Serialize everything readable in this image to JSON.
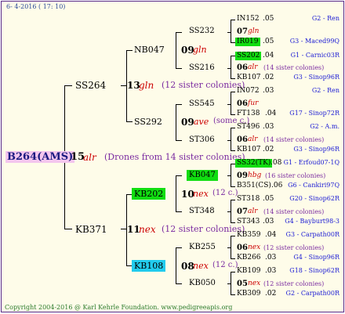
{
  "header": "6- 4-2016 ( 17: 10)",
  "footer": "Copyright 2004-2016 @ Karl Kehrle Foundation.   www.pedigreeapis.org",
  "root": {
    "id": "B264(AMS)",
    "num": "15",
    "race": "alr",
    "note": "(Drones from 14 sister colonies)"
  },
  "gen1": [
    {
      "id": "SS264",
      "num": "13",
      "race": "gln",
      "note": "(12 sister colonies)"
    },
    {
      "id": "KB371",
      "num": "11",
      "race": "nex",
      "note": "(12 sister colonies)"
    }
  ],
  "gen2": [
    {
      "id": "NB047",
      "num": "09",
      "race": "gln",
      "note": ""
    },
    {
      "id": "SS292",
      "num": "09",
      "race": "ave",
      "note": "(some c.)"
    },
    {
      "id": "KB202",
      "num": "10",
      "race": "nex",
      "note": "(12 c.)"
    },
    {
      "id": "KB108",
      "num": "08",
      "race": "nex",
      "note": "(12 c.)"
    }
  ],
  "gen3": [
    {
      "id": "SS232",
      "num": "07",
      "race": "gln",
      "note": ""
    },
    {
      "id": "SS216",
      "num": "06",
      "race": "alr",
      "note": "(14 sister colonies)"
    },
    {
      "id": "SS545",
      "num": "06",
      "race": "fur",
      "note": ""
    },
    {
      "id": "ST306",
      "num": "06",
      "race": "alr",
      "note": "(14 sister colonies)"
    },
    {
      "id": "KB047",
      "num": "09",
      "race": "hbg",
      "note": "(16 sister colonies)"
    },
    {
      "id": "ST348",
      "num": "07",
      "race": "alr",
      "note": "(14 sister colonies)"
    },
    {
      "id": "KB255",
      "num": "06",
      "race": "nex",
      "note": "(12 sister colonies)"
    },
    {
      "id": "KB050",
      "num": "05",
      "race": "nex",
      "note": "(12 sister colonies)"
    }
  ],
  "gen4": [
    {
      "id": "IN152",
      "year": ".05",
      "origin": "G2 - Ren"
    },
    {
      "id": "IR019",
      "year": ".05",
      "origin": "G3 - Maced99Q"
    },
    {
      "id": "SS202",
      "year": ".04",
      "origin": "G1 - Carnic03R"
    },
    {
      "id": "KB107",
      "year": ".02",
      "origin": "G3 - Sinop96R"
    },
    {
      "id": "IN072",
      "year": ".03",
      "origin": "G2 - Ren"
    },
    {
      "id": "FT138",
      "year": ".04",
      "origin": "G17 - Sinop72R"
    },
    {
      "id": "ST496",
      "year": ".03",
      "origin": "G2 - A.m."
    },
    {
      "id": "KB107",
      "year": ".02",
      "origin": "G3 - Sinop96R"
    },
    {
      "id": "SS32(TK)",
      "year": ".08",
      "origin": "G1 - Erfoud07-1Q"
    },
    {
      "id": "B351(CS)",
      "year": ".06",
      "origin": "G6 - Cankiri97Q"
    },
    {
      "id": "ST318",
      "year": ".05",
      "origin": "G20 - Sinop62R"
    },
    {
      "id": "ST343",
      "year": ".03",
      "origin": "G4 - Bayburt98-3"
    },
    {
      "id": "KB359",
      "year": ".04",
      "origin": "G3 - Carpath00R"
    },
    {
      "id": "KB266",
      "year": ".03",
      "origin": "G4 - Sinop96R"
    },
    {
      "id": "KB109",
      "year": ".03",
      "origin": "G18 - Sinop62R"
    },
    {
      "id": "KB309",
      "year": ".02",
      "origin": "G2 - Carpath00R"
    }
  ],
  "highlight_colors": {
    "green": "#11dd11",
    "cyan": "#22ccee",
    "pink": "#f4c6ee"
  }
}
